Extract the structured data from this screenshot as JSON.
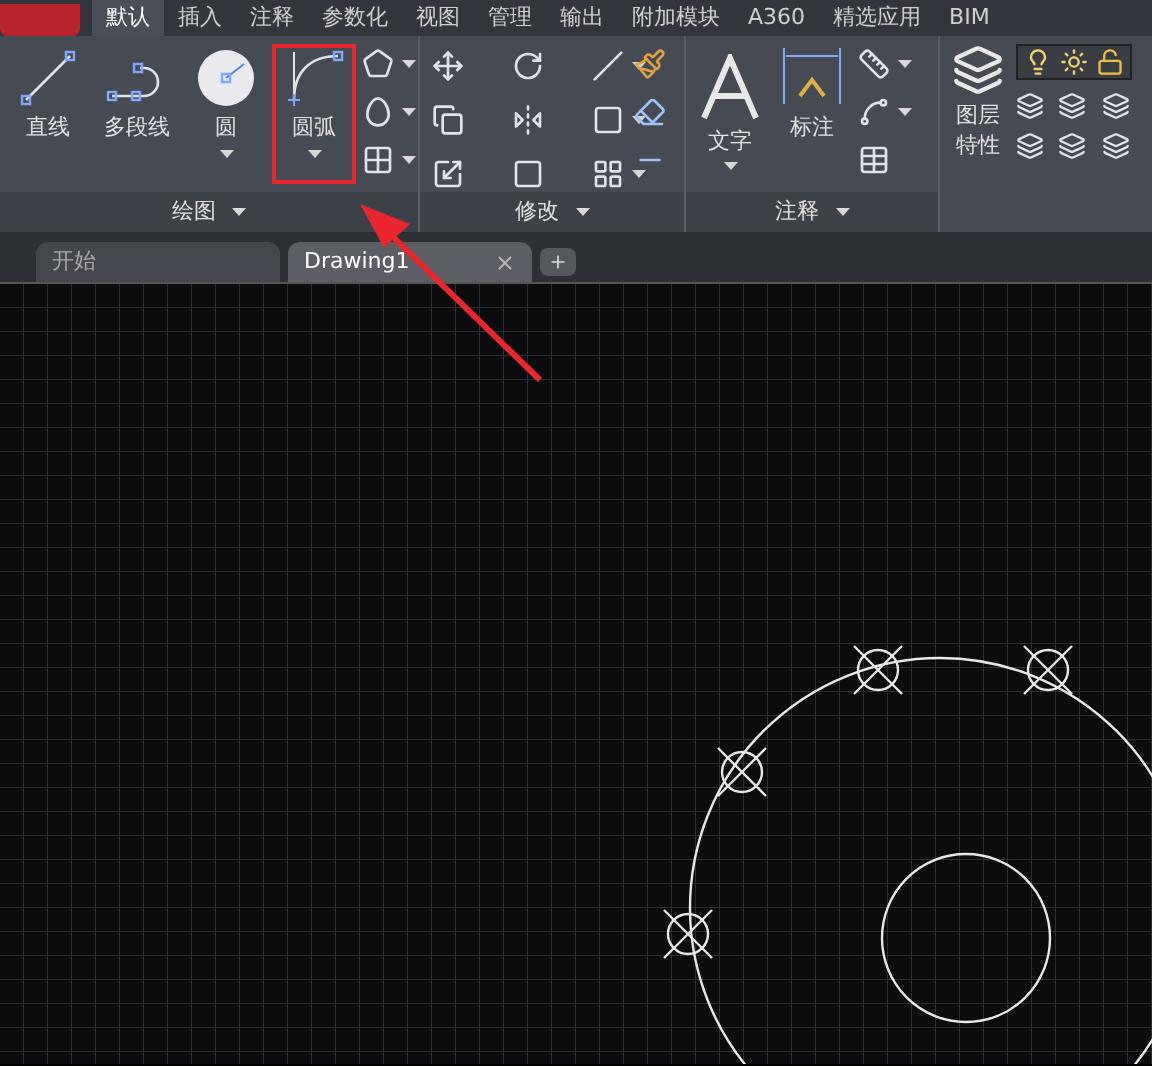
{
  "menu_tabs": [
    {
      "label": "默认",
      "selected": true
    },
    {
      "label": "插入",
      "selected": false
    },
    {
      "label": "注释",
      "selected": false
    },
    {
      "label": "参数化",
      "selected": false
    },
    {
      "label": "视图",
      "selected": false
    },
    {
      "label": "管理",
      "selected": false
    },
    {
      "label": "输出",
      "selected": false
    },
    {
      "label": "附加模块",
      "selected": false
    },
    {
      "label": "A360",
      "selected": false
    },
    {
      "label": "精选应用",
      "selected": false
    },
    {
      "label": "BIM",
      "selected": false
    }
  ],
  "draw_panel": {
    "title": "绘图",
    "tools": [
      {
        "kind": "line",
        "label": "直线",
        "dropdown": false,
        "annotated": false
      },
      {
        "kind": "polyline",
        "label": "多段线",
        "dropdown": false,
        "annotated": false
      },
      {
        "kind": "circle",
        "label": "圆",
        "dropdown": true,
        "annotated": false
      },
      {
        "kind": "arc",
        "label": "圆弧",
        "dropdown": true,
        "annotated": true
      }
    ]
  },
  "modify_panel": {
    "title": "修改"
  },
  "annotate_panel": {
    "title": "注释",
    "tools": [
      {
        "kind": "text",
        "label": "文字",
        "dropdown": true
      },
      {
        "kind": "dimension",
        "label": "标注",
        "dropdown": false
      }
    ]
  },
  "layer_panel": {
    "tool": "图层特性"
  },
  "doc_tabs": [
    {
      "label": "开始",
      "selected": false,
      "closable": false
    },
    {
      "label": "Drawing1",
      "selected": true,
      "closable": true
    }
  ]
}
